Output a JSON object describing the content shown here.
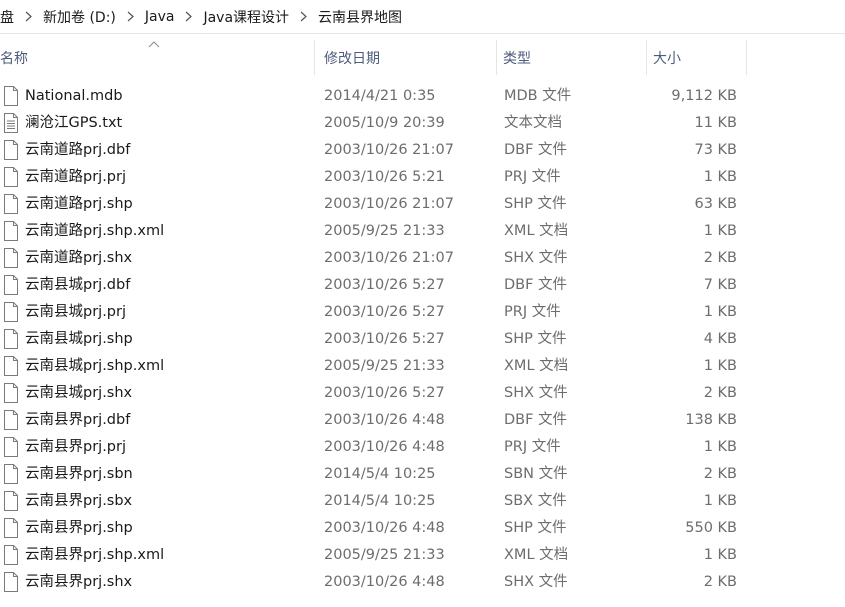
{
  "breadcrumb": {
    "items": [
      "盘",
      "新加卷 (D:)",
      "Java",
      "Java课程设计",
      "云南县界地图"
    ]
  },
  "columns": {
    "name": "名称",
    "date": "修改日期",
    "type": "类型",
    "size": "大小"
  },
  "files": [
    {
      "name": "National.mdb",
      "date": "2014/4/21 0:35",
      "type": "MDB 文件",
      "size": "9,112 KB",
      "icon": "file-icon"
    },
    {
      "name": "澜沧江GPS.txt",
      "date": "2005/10/9 20:39",
      "type": "文本文档",
      "size": "11 KB",
      "icon": "text-file-icon"
    },
    {
      "name": "云南道路prj.dbf",
      "date": "2003/10/26 21:07",
      "type": "DBF 文件",
      "size": "73 KB",
      "icon": "file-icon"
    },
    {
      "name": "云南道路prj.prj",
      "date": "2003/10/26 5:21",
      "type": "PRJ 文件",
      "size": "1 KB",
      "icon": "file-icon"
    },
    {
      "name": "云南道路prj.shp",
      "date": "2003/10/26 21:07",
      "type": "SHP 文件",
      "size": "63 KB",
      "icon": "file-icon"
    },
    {
      "name": "云南道路prj.shp.xml",
      "date": "2005/9/25 21:33",
      "type": "XML 文档",
      "size": "1 KB",
      "icon": "file-icon"
    },
    {
      "name": "云南道路prj.shx",
      "date": "2003/10/26 21:07",
      "type": "SHX 文件",
      "size": "2 KB",
      "icon": "file-icon"
    },
    {
      "name": "云南县城prj.dbf",
      "date": "2003/10/26 5:27",
      "type": "DBF 文件",
      "size": "7 KB",
      "icon": "file-icon"
    },
    {
      "name": "云南县城prj.prj",
      "date": "2003/10/26 5:27",
      "type": "PRJ 文件",
      "size": "1 KB",
      "icon": "file-icon"
    },
    {
      "name": "云南县城prj.shp",
      "date": "2003/10/26 5:27",
      "type": "SHP 文件",
      "size": "4 KB",
      "icon": "file-icon"
    },
    {
      "name": "云南县城prj.shp.xml",
      "date": "2005/9/25 21:33",
      "type": "XML 文档",
      "size": "1 KB",
      "icon": "file-icon"
    },
    {
      "name": "云南县城prj.shx",
      "date": "2003/10/26 5:27",
      "type": "SHX 文件",
      "size": "2 KB",
      "icon": "file-icon"
    },
    {
      "name": "云南县界prj.dbf",
      "date": "2003/10/26 4:48",
      "type": "DBF 文件",
      "size": "138 KB",
      "icon": "file-icon"
    },
    {
      "name": "云南县界prj.prj",
      "date": "2003/10/26 4:48",
      "type": "PRJ 文件",
      "size": "1 KB",
      "icon": "file-icon"
    },
    {
      "name": "云南县界prj.sbn",
      "date": "2014/5/4 10:25",
      "type": "SBN 文件",
      "size": "2 KB",
      "icon": "file-icon"
    },
    {
      "name": "云南县界prj.sbx",
      "date": "2014/5/4 10:25",
      "type": "SBX 文件",
      "size": "1 KB",
      "icon": "file-icon"
    },
    {
      "name": "云南县界prj.shp",
      "date": "2003/10/26 4:48",
      "type": "SHP 文件",
      "size": "550 KB",
      "icon": "file-icon"
    },
    {
      "name": "云南县界prj.shp.xml",
      "date": "2005/9/25 21:33",
      "type": "XML 文档",
      "size": "1 KB",
      "icon": "file-icon"
    },
    {
      "name": "云南县界prj.shx",
      "date": "2003/10/26 4:48",
      "type": "SHX 文件",
      "size": "2 KB",
      "icon": "file-icon"
    }
  ]
}
